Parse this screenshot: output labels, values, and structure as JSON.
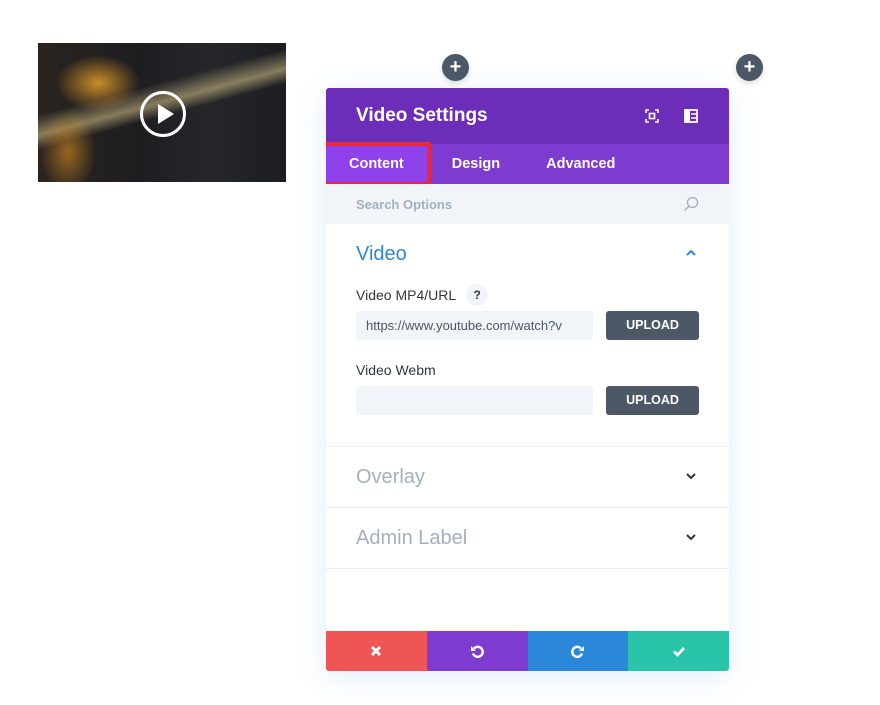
{
  "preview": {
    "thumbnail_alt": "guitar-video-thumbnail",
    "play_icon": "play-icon"
  },
  "add_buttons": [
    {
      "icon": "plus-icon",
      "label": "+"
    },
    {
      "icon": "plus-icon",
      "label": "+"
    }
  ],
  "modal": {
    "title": "Video Settings",
    "header_icons": [
      "expand-icon",
      "sidebar-layout-icon"
    ],
    "tabs": [
      {
        "label": "Content",
        "active": true
      },
      {
        "label": "Design",
        "active": false
      },
      {
        "label": "Advanced",
        "active": false
      }
    ],
    "search": {
      "placeholder": "Search Options",
      "value": ""
    },
    "sections": {
      "video": {
        "title": "Video",
        "expanded": true,
        "fields": {
          "mp4": {
            "label": "Video MP4/URL",
            "help": "?",
            "value": "https://www.youtube.com/watch?v",
            "button": "UPLOAD"
          },
          "webm": {
            "label": "Video Webm",
            "value": "",
            "button": "UPLOAD"
          }
        }
      },
      "overlay": {
        "title": "Overlay",
        "expanded": false
      },
      "admin_label": {
        "title": "Admin Label",
        "expanded": false
      }
    },
    "footer": {
      "cancel": {
        "icon": "close-icon",
        "color": "#ef5555"
      },
      "undo": {
        "icon": "undo-icon",
        "color": "#7e3bd0"
      },
      "redo": {
        "icon": "redo-icon",
        "color": "#2b87da"
      },
      "save": {
        "icon": "check-icon",
        "color": "#29c4a9"
      }
    }
  },
  "colors": {
    "header": "#6c2eb9",
    "tabs_bar": "#7e3bd0",
    "active_tab": "#8f42ec",
    "highlight_outline": "#e9283b",
    "section_open": "#2b87da",
    "section_closed": "#a2b0c1",
    "button_dark": "#4c5866"
  }
}
